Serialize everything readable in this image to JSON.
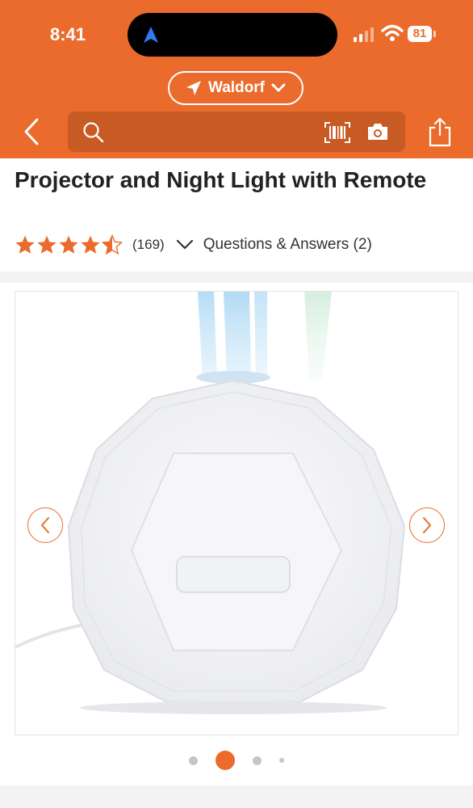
{
  "status_bar": {
    "time": "8:41",
    "battery": "81"
  },
  "header": {
    "location_label": "Waldorf",
    "search": {
      "value": "",
      "placeholder": ""
    },
    "icons": [
      "back-arrow-icon",
      "search-icon",
      "barcode-icon",
      "camera-icon",
      "share-icon",
      "location-arrow-icon",
      "chevron-down-icon"
    ],
    "colors": {
      "brand": "#ea6b2b",
      "search_bg": "#c85a24"
    }
  },
  "product": {
    "title": "Projector and Night Light with Remote",
    "rating": 4.5,
    "rating_max": 5,
    "review_count": "(169)",
    "qa_link": "Questions & Answers (2)",
    "star_color": "#ea6b2b"
  },
  "carousel": {
    "image_count": 4,
    "active_index": 1,
    "active_dot_color": "#ea6b2b",
    "prev_icon": "chevron-left-icon",
    "next_icon": "chevron-right-icon"
  }
}
